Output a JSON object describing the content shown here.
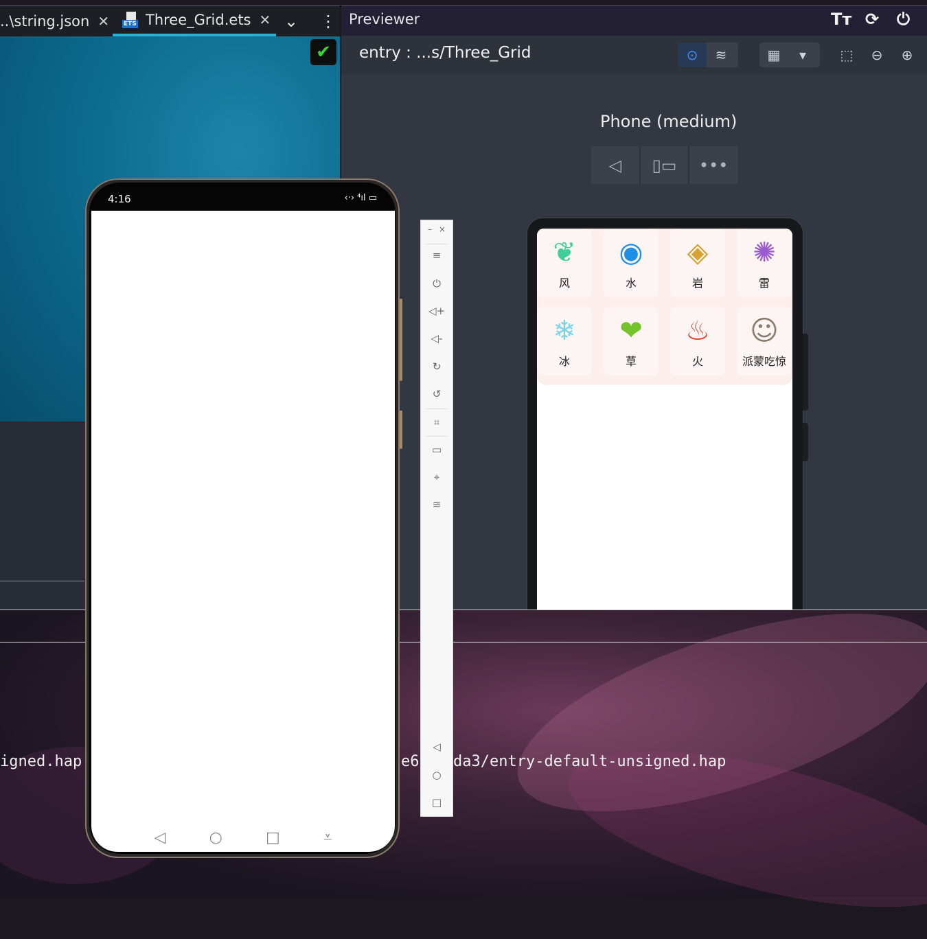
{
  "tabs": [
    {
      "label": "..\\string.json",
      "close": "✕"
    },
    {
      "label": "Three_Grid.ets",
      "close": "✕",
      "badge": "ETS"
    }
  ],
  "tab_overflow": "⌄",
  "tab_more": "⋮",
  "previewer": {
    "title": "Previewer",
    "path": "entry : ...s/Three_Grid",
    "device_name": "Phone (medium)",
    "top_icons": [
      "Tт",
      "⟳",
      "⏻"
    ]
  },
  "preview_grid": [
    {
      "name": "风",
      "glyph": "❦",
      "color": "#3fcf9a"
    },
    {
      "name": "水",
      "glyph": "◉",
      "color": "#1d8fe6"
    },
    {
      "name": "岩",
      "glyph": "◈",
      "color": "#d7a233"
    },
    {
      "name": "雷",
      "glyph": "✺",
      "color": "#9b5bd0"
    },
    {
      "name": "冰",
      "glyph": "❄",
      "color": "#7fd3e8"
    },
    {
      "name": "草",
      "glyph": "❤",
      "color": "#74c22c"
    },
    {
      "name": "火",
      "glyph": "♨",
      "color": "#e2432c"
    },
    {
      "name": "派蒙吃惊",
      "glyph": "☺",
      "color": "#8a7a6a"
    }
  ],
  "emulator": {
    "time": "4:16",
    "status_icons": "‹·› ⁴ıl ▭"
  },
  "terminal": {
    "left_fragment": "igned.hap",
    "right_fragment": "e6",
    "right_path": "da3/entry-default-unsigned.hap"
  }
}
